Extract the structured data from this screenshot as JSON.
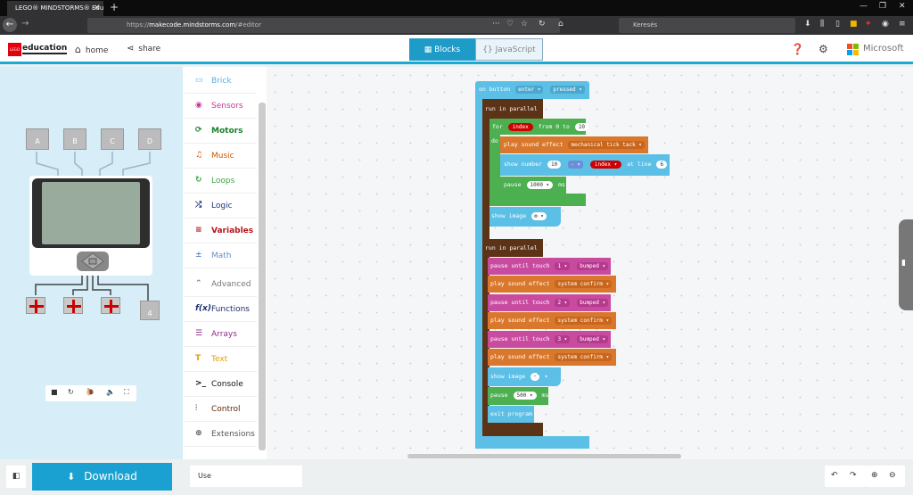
{
  "browser": {
    "tab_title": "LEGO® MINDSTORMS® Edu",
    "url_base": "https://",
    "url_host": "makecode.mindstorms.com",
    "url_path": "/#editor",
    "search_placeholder": "Keresés"
  },
  "header": {
    "home_label": "home",
    "share_label": "share",
    "logo_text": "education",
    "brand": "Microsoft",
    "tabs": [
      {
        "label": "Blocks",
        "active": true
      },
      {
        "label": "JavaScript",
        "active": false
      }
    ]
  },
  "simulator": {
    "ports_top": [
      "A",
      "B",
      "C",
      "D"
    ],
    "port_4_label": "4"
  },
  "toolbox": {
    "categories": [
      {
        "label": "Brick",
        "color": "#5dade2",
        "icon": "brick-icon"
      },
      {
        "label": "Sensors",
        "color": "#c63696",
        "icon": "sensor-icon"
      },
      {
        "label": "Motors",
        "color": "#1a7f2a",
        "icon": "motor-icon"
      },
      {
        "label": "Music",
        "color": "#d35400",
        "icon": "music-icon"
      },
      {
        "label": "Loops",
        "color": "#3aa53a",
        "icon": "loop-icon"
      },
      {
        "label": "Logic",
        "color": "#16347a",
        "icon": "logic-icon"
      },
      {
        "label": "Variables",
        "color": "#b7131a",
        "icon": "variables-icon"
      },
      {
        "label": "Math",
        "color": "#6a8cc7",
        "icon": "math-icon"
      },
      {
        "label": "Advanced",
        "color": "#777777",
        "icon": "advanced-icon"
      },
      {
        "label": "Functions",
        "color": "#1c2f6b",
        "icon": "functions-icon"
      },
      {
        "label": "Arrays",
        "color": "#8e2a84",
        "icon": "arrays-icon"
      },
      {
        "label": "Text",
        "color": "#e1a100",
        "icon": "text-icon"
      },
      {
        "label": "Console",
        "color": "#111111",
        "icon": "console-icon"
      },
      {
        "label": "Control",
        "color": "#5b2a0c",
        "icon": "control-icon"
      },
      {
        "label": "Extensions",
        "color": "#555555",
        "icon": "extensions-icon"
      }
    ]
  },
  "program": {
    "on_button": "on button",
    "enter": "enter ▾",
    "pressed": "pressed ▾",
    "run_in_parallel": "run in parallel",
    "for": "for",
    "index": "index",
    "from_0_to": "from 0 to",
    "ten": "10",
    "do": "do",
    "play_sound_effect": "play sound effect",
    "mechanical_tick_tack": "mechanical tick tack ▾",
    "show_number": "show number",
    "minus": "- ▾",
    "index_dd": "index ▾",
    "at_line": "at line",
    "six": "6",
    "pause": "pause",
    "pause_1000": "1000 ▾",
    "ms": "ms",
    "show_image": "show image",
    "run_in_parallel_2": "run in parallel",
    "pause_until_touch": "pause until touch",
    "touch_1": "1 ▾",
    "touch_2": "2 ▾",
    "touch_3": "3 ▾",
    "bumped": "bumped ▾",
    "system_confirm": "system confirm ▾",
    "pause_500": "500 ▾",
    "exit_program": "exit program"
  },
  "footer": {
    "download_label": "Download",
    "project_name": "Use"
  }
}
